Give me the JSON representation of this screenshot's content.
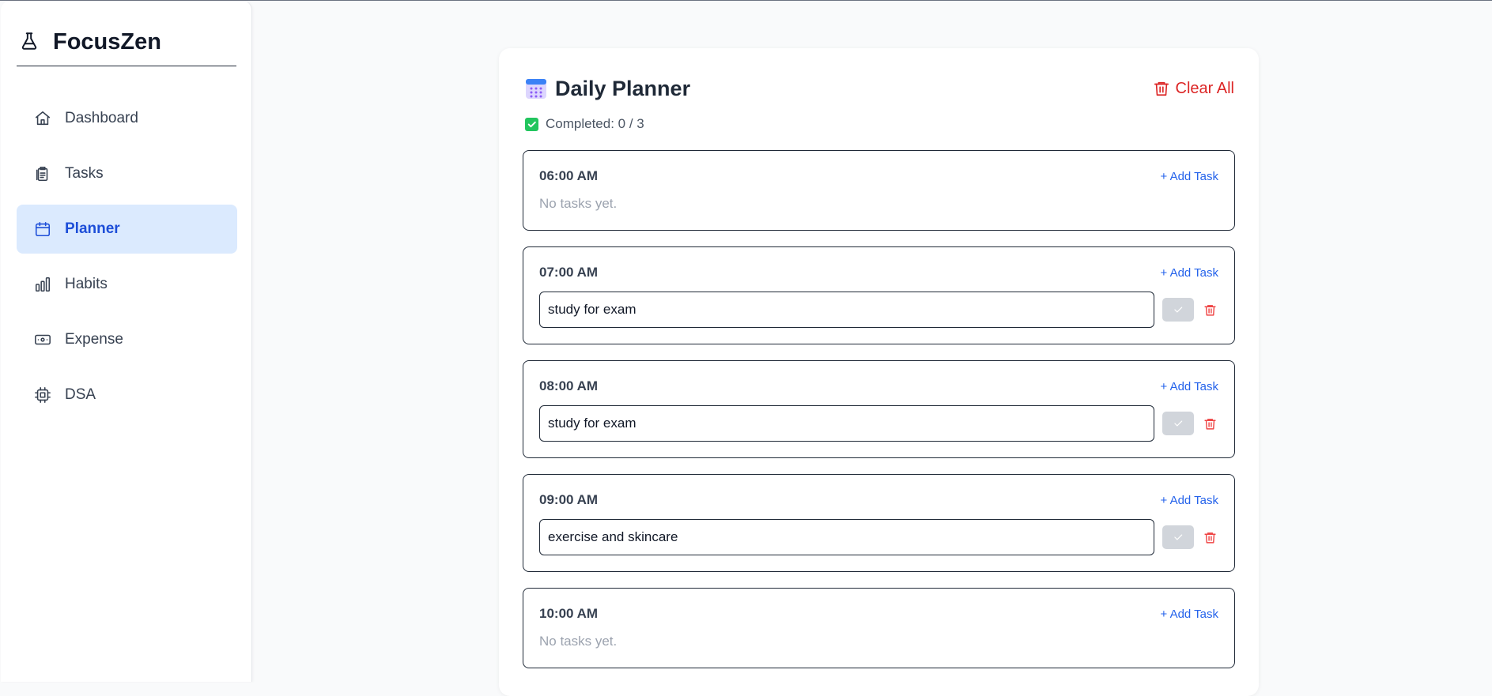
{
  "app": {
    "name": "FocusZen"
  },
  "sidebar": {
    "items": [
      {
        "label": "Dashboard",
        "icon": "home-icon",
        "active": false
      },
      {
        "label": "Tasks",
        "icon": "clipboard-icon",
        "active": false
      },
      {
        "label": "Planner",
        "icon": "calendar-icon",
        "active": true
      },
      {
        "label": "Habits",
        "icon": "bar-chart-icon",
        "active": false
      },
      {
        "label": "Expense",
        "icon": "banknote-icon",
        "active": false
      },
      {
        "label": "DSA",
        "icon": "cpu-icon",
        "active": false
      }
    ]
  },
  "planner": {
    "title": "Daily Planner",
    "title_icon": "calendar-emoji-icon",
    "clear_all_label": "Clear All",
    "completed_text": "Completed: 0 / 3",
    "add_task_label": "+ Add Task",
    "empty_text": "No tasks yet.",
    "slots": [
      {
        "time": "06:00 AM",
        "task": null
      },
      {
        "time": "07:00 AM",
        "task": "study for exam"
      },
      {
        "time": "08:00 AM",
        "task": "study for exam"
      },
      {
        "time": "09:00 AM",
        "task": "exercise and skincare"
      },
      {
        "time": "10:00 AM",
        "task": null
      }
    ]
  },
  "colors": {
    "accent": "#2563eb",
    "active_bg": "#dbeafe",
    "danger": "#dc2626",
    "success": "#22c55e"
  }
}
